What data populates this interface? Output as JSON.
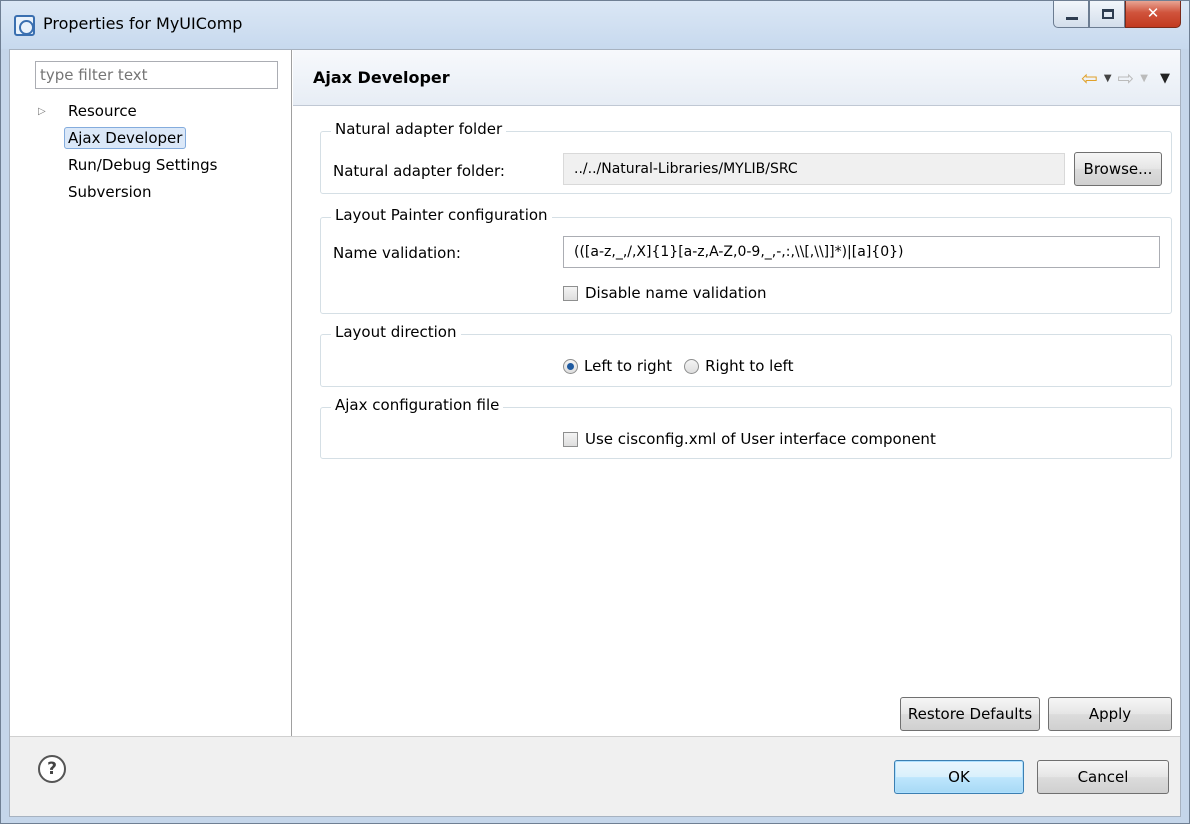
{
  "window": {
    "title": "Properties for MyUIComp"
  },
  "filter": {
    "placeholder": "type filter text"
  },
  "tree": {
    "items": [
      {
        "label": "Resource",
        "expandable": true
      },
      {
        "label": "Ajax Developer",
        "selected": true
      },
      {
        "label": "Run/Debug Settings"
      },
      {
        "label": "Subversion"
      }
    ]
  },
  "page": {
    "title": "Ajax Developer",
    "nav": {
      "back_icon": "arrow-left-icon",
      "forward_icon": "arrow-right-icon",
      "menu_icon": "view-menu-icon"
    }
  },
  "groups": {
    "adapter": {
      "legend": "Natural adapter folder",
      "field_label": "Natural adapter folder:",
      "field_value": "../../Natural-Libraries/MYLIB/SRC",
      "browse_label": "Browse..."
    },
    "painter": {
      "legend": "Layout Painter configuration",
      "field_label": "Name validation:",
      "field_value": "(([a-z,_,/,X]{1}[a-z,A-Z,0-9,_,-,:,\\\\[,\\\\]]*)|[a]{0})",
      "disable_label": "Disable name validation",
      "disable_checked": false
    },
    "direction": {
      "legend": "Layout direction",
      "ltr_label": "Left to right",
      "rtl_label": "Right to left",
      "selected": "ltr"
    },
    "config": {
      "legend": "Ajax configuration file",
      "use_label": "Use cisconfig.xml of User interface component",
      "use_checked": false
    }
  },
  "page_buttons": {
    "restore": "Restore Defaults",
    "apply": "Apply"
  },
  "dialog_buttons": {
    "ok": "OK",
    "cancel": "Cancel",
    "help_icon": "help-icon"
  }
}
